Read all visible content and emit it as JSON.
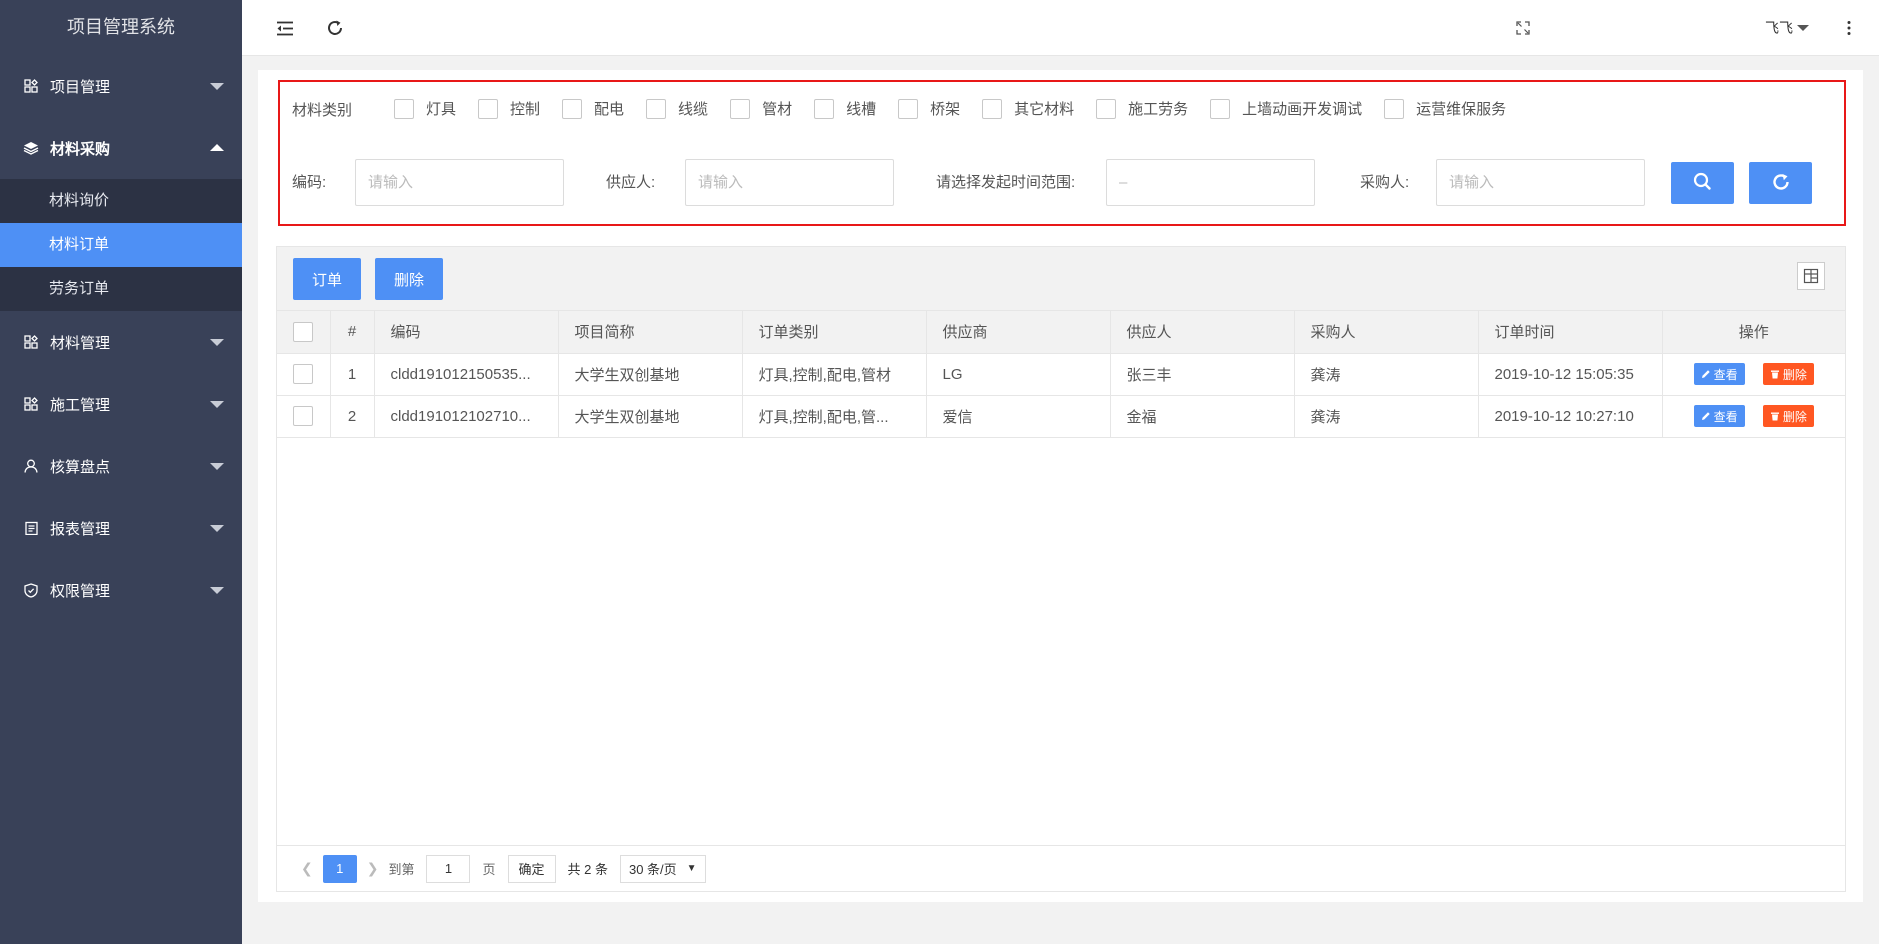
{
  "app_title": "项目管理系统",
  "sidebar": {
    "items": [
      {
        "label": "项目管理",
        "icon": "modules-icon",
        "open": false
      },
      {
        "label": "材料采购",
        "icon": "layers-icon",
        "open": true,
        "children": [
          {
            "label": "材料询价",
            "active": false
          },
          {
            "label": "材料订单",
            "active": true
          },
          {
            "label": "劳务订单",
            "active": false
          }
        ]
      },
      {
        "label": "材料管理",
        "icon": "modules-icon",
        "open": false
      },
      {
        "label": "施工管理",
        "icon": "modules-icon",
        "open": false
      },
      {
        "label": "核算盘点",
        "icon": "user-icon",
        "open": false
      },
      {
        "label": "报表管理",
        "icon": "report-icon",
        "open": false
      },
      {
        "label": "权限管理",
        "icon": "shield-icon",
        "open": false
      }
    ]
  },
  "header": {
    "user_name": "飞飞"
  },
  "filter": {
    "category_label": "材料类别",
    "categories": [
      "灯具",
      "控制",
      "配电",
      "线缆",
      "管材",
      "线槽",
      "桥架",
      "其它材料",
      "施工劳务",
      "上墙动画开发调试",
      "运营维保服务"
    ],
    "code_label": "编码:",
    "code_placeholder": "请输入",
    "supplier_person_label": "供应人:",
    "supplier_person_placeholder": "请输入",
    "date_range_label": "请选择发起时间范围:",
    "date_range_value": "–",
    "buyer_label": "采购人:",
    "buyer_placeholder": "请输入"
  },
  "toolbar": {
    "order_label": "订单",
    "delete_label": "删除"
  },
  "table": {
    "columns": [
      "#",
      "编码",
      "项目简称",
      "订单类别",
      "供应商",
      "供应人",
      "采购人",
      "订单时间",
      "操作"
    ],
    "rows": [
      {
        "index": "1",
        "code": "cldd191012150535...",
        "project": "大学生双创基地",
        "category": "灯具,控制,配电,管材",
        "supplier": "LG",
        "supplier_person": "张三丰",
        "buyer": "龚涛",
        "time": "2019-10-12 15:05:35"
      },
      {
        "index": "2",
        "code": "cldd191012102710...",
        "project": "大学生双创基地",
        "category": "灯具,控制,配电,管...",
        "supplier": "爱信",
        "supplier_person": "金福",
        "buyer": "龚涛",
        "time": "2019-10-12 10:27:10"
      }
    ],
    "view_label": "查看",
    "delete_label": "删除"
  },
  "pager": {
    "current_page": "1",
    "goto_label": "到第",
    "goto_value": "1",
    "page_suffix": "页",
    "confirm_label": "确定",
    "total_label": "共 2 条",
    "page_size": "30 条/页"
  }
}
